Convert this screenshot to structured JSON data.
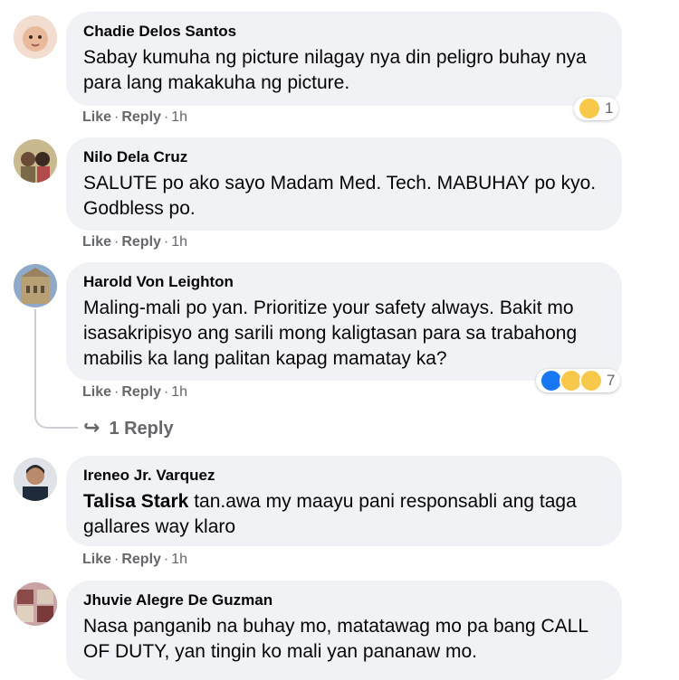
{
  "colors": {
    "bubble": "#f0f2f5",
    "meta_text": "#65676b",
    "name_text": "#050505",
    "like_blue": "#1877f2",
    "emoji_yellow": "#f7c84a"
  },
  "comments": [
    {
      "author": "Chadie Delos Santos",
      "text": "Sabay kumuha ng picture nilagay nya din peligro buhay nya para lang makakuha ng picture.",
      "like": "Like",
      "reply": "Reply",
      "time": "1h",
      "reactions": {
        "icons": [
          "haha-reaction-icon"
        ],
        "count": "1"
      }
    },
    {
      "author": "Nilo Dela Cruz",
      "text": "SALUTE po ako sayo Madam Med. Tech. MABUHAY po kyo. Godbless po.",
      "like": "Like",
      "reply": "Reply",
      "time": "1h"
    },
    {
      "author": "Harold Von Leighton",
      "text": "Maling-mali po yan. Prioritize your safety always. Bakit mo isasakripisyo ang sarili mong kaligtasan para sa trabahong mabilis ka lang palitan kapag mamatay ka?",
      "like": "Like",
      "reply": "Reply",
      "time": "1h",
      "reactions": {
        "icons": [
          "like-reaction-icon",
          "haha-reaction-icon",
          "sad-reaction-icon"
        ],
        "count": "7"
      },
      "replies_link": "1 Reply",
      "replies_icon": "reply-arrow-icon"
    },
    {
      "author": "Ireneo Jr. Varquez",
      "tagged_user": "Talisa Stark",
      "text": "tan.awa my maayu pani responsabli ang taga gallares way klaro",
      "like": "Like",
      "reply": "Reply",
      "time": "1h"
    },
    {
      "author": "Jhuvie Alegre De Guzman",
      "text": "Nasa panganib na buhay mo, matatawag mo pa bang CALL OF DUTY, yan tingin ko mali yan pananaw mo."
    }
  ],
  "separator": "·"
}
